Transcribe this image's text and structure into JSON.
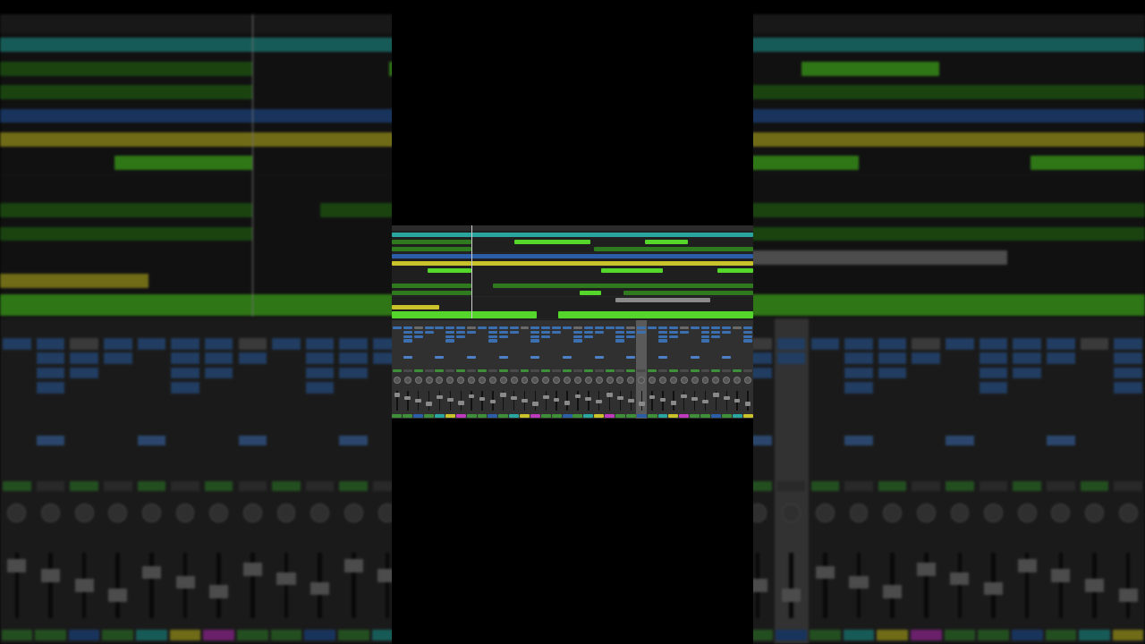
{
  "app": {
    "colors": {
      "background": "#000000",
      "track_bg": "#1f1f1f",
      "region_green": "#55d62a",
      "region_green_dim": "#2f7a1e",
      "region_teal": "#2aa6a0",
      "region_yellow": "#c9c22a",
      "region_blue": "#2c5ea8",
      "mixer_bg": "#2a2a2a",
      "plugin_slot": "#3c6fb0",
      "selected_strip": "#5a5a5a"
    },
    "icons": [
      "playhead-icon",
      "fader-icon",
      "pan-knob-icon"
    ]
  },
  "arrange": {
    "track_count": 12,
    "playhead_bar_fraction": 0.22
  },
  "mixer": {
    "channel_count": 34,
    "selected_channel_index": 23
  }
}
